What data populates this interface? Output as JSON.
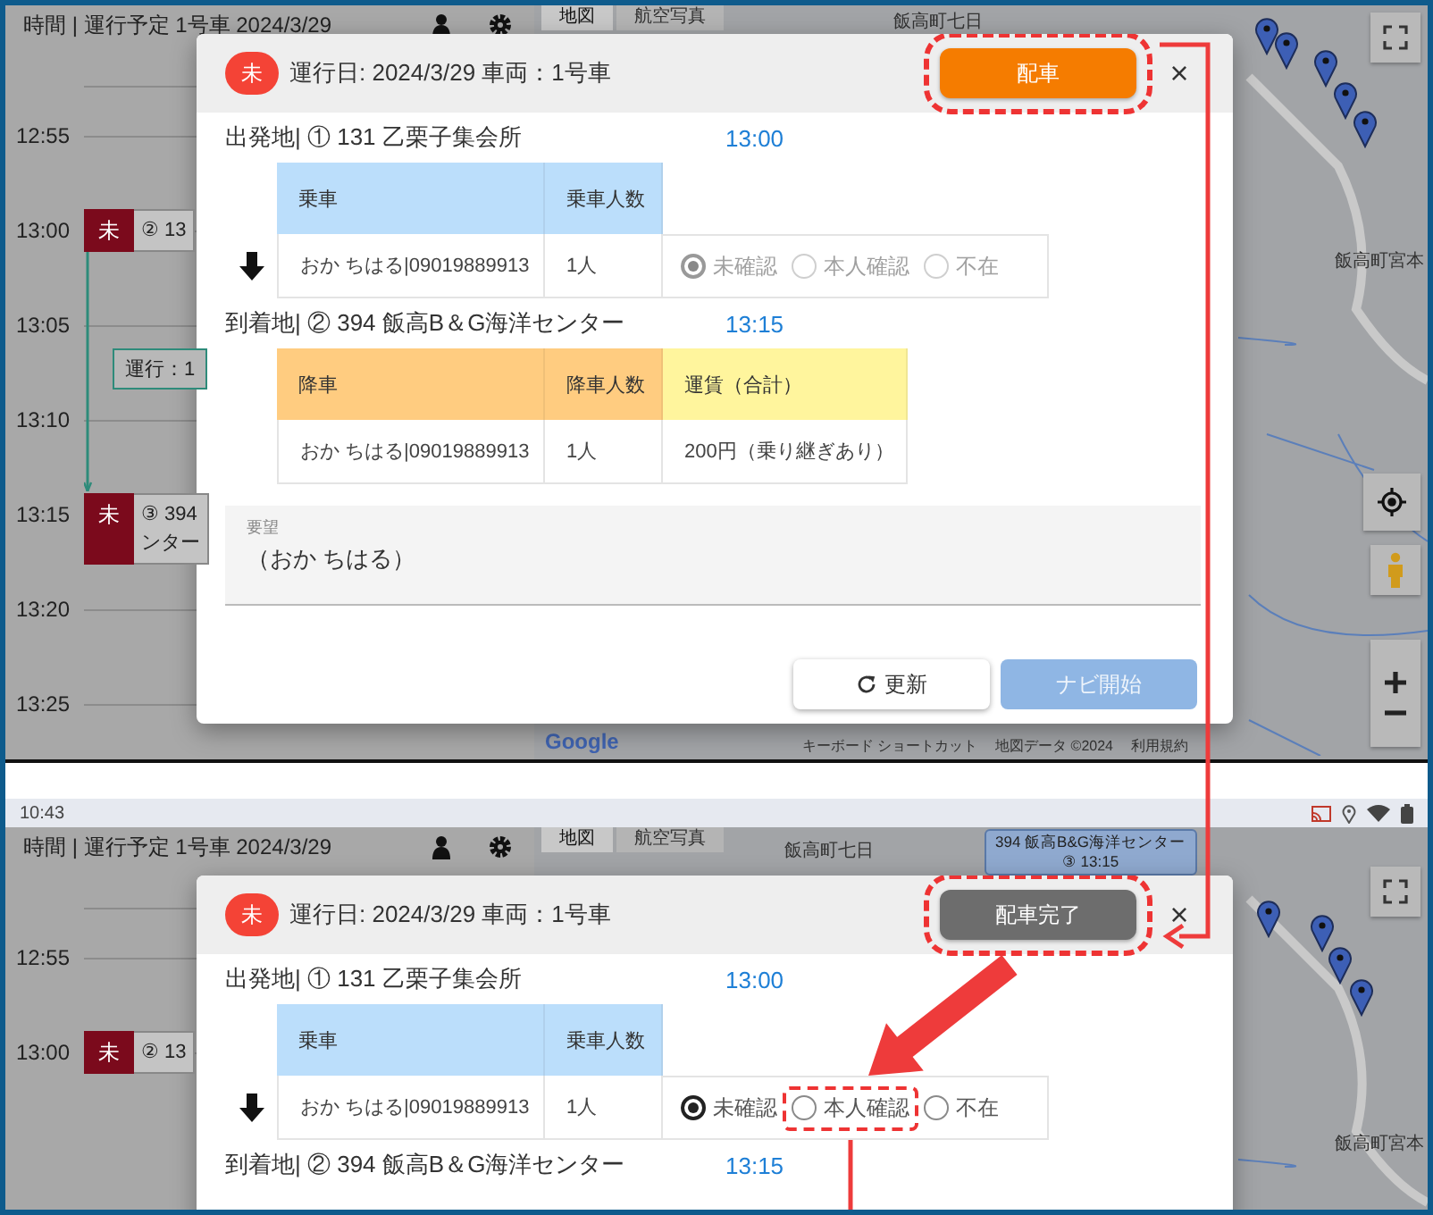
{
  "screens": [
    {
      "timeline": {
        "title": "時間 | 運行予定 1号車 2024/3/29",
        "slots": [
          {
            "time": "12:55"
          },
          {
            "time": "13:00",
            "event": {
              "badge": "未",
              "lines": [
                "② 13"
              ]
            }
          },
          {
            "time": "13:05",
            "note": "運行：1"
          },
          {
            "time": "13:10"
          },
          {
            "time": "13:15",
            "event": {
              "badge": "未",
              "lines": [
                "③ 394",
                "ンター"
              ]
            }
          },
          {
            "time": "13:20"
          },
          {
            "time": "13:25"
          }
        ]
      },
      "map": {
        "tabs": [
          {
            "label": "地図",
            "selected": true
          },
          {
            "label": "航空写真",
            "selected": false
          }
        ],
        "places": [
          "飯高町七日",
          "飯高町宮本"
        ],
        "logo": "Google",
        "attribution": [
          "キーボード ショートカット",
          "地図データ ©2024",
          "利用規約"
        ]
      },
      "dialog": {
        "badge": "未",
        "title": "運行日: 2024/3/29 車両：1号車",
        "dispatch_button": {
          "label": "配車",
          "kind": "pending",
          "highlighted": true
        },
        "close": "×",
        "stops": [
          {
            "kind": "pickup",
            "label": "出発地| ① 131 乙栗子集会所",
            "time": "13:00",
            "columns": [
              {
                "label": "乗車",
                "color": "#bbdefb"
              },
              {
                "label": "乗車人数",
                "color": "#bbdefb"
              }
            ],
            "rows": [
              {
                "cells": [
                  "おか ちはる|09019889913",
                  "1人"
                ],
                "presence": {
                  "disabled": true,
                  "options": [
                    {
                      "label": "未確認",
                      "selected": true,
                      "highlighted": false
                    },
                    {
                      "label": "本人確認",
                      "selected": false,
                      "highlighted": false
                    },
                    {
                      "label": "不在",
                      "selected": false,
                      "highlighted": false
                    }
                  ]
                }
              }
            ]
          },
          {
            "kind": "dropoff",
            "label": "到着地| ② 394 飯高B＆G海洋センター",
            "time": "13:15",
            "columns": [
              {
                "label": "降車",
                "color": "#ffcc80"
              },
              {
                "label": "降車人数",
                "color": "#ffcc80"
              },
              {
                "label": "運賃（合計）",
                "color": "#fff59d"
              }
            ],
            "rows": [
              {
                "cells": [
                  "おか ちはる|09019889913",
                  "1人",
                  "200円（乗り継ぎあり）"
                ]
              }
            ]
          }
        ],
        "request": {
          "label": "要望",
          "value": "（おか ちはる）"
        },
        "footer_buttons": [
          {
            "label": "更新",
            "kind": "refresh"
          },
          {
            "label": "ナビ開始",
            "kind": "primary",
            "disabled": true
          }
        ]
      }
    },
    {
      "status_bar": {
        "time": "10:43"
      },
      "timeline": {
        "title": "時間 | 運行予定 1号車 2024/3/29",
        "slots": [
          {
            "time": "12:55"
          },
          {
            "time": "13:00",
            "event": {
              "badge": "未",
              "lines": [
                "② 13"
              ]
            }
          }
        ]
      },
      "map": {
        "tabs": [
          {
            "label": "地図",
            "selected": true
          },
          {
            "label": "航空写真",
            "selected": false
          }
        ],
        "places": [
          "飯高町七日",
          "飯高町宮本"
        ],
        "popup": {
          "title": "394 飯高B&G海洋センター",
          "subtitle": "③ 13:15"
        }
      },
      "dialog": {
        "badge": "未",
        "title": "運行日: 2024/3/29 車両：1号車",
        "dispatch_button": {
          "label": "配車完了",
          "kind": "done",
          "highlighted": true
        },
        "close": "×",
        "stops": [
          {
            "kind": "pickup",
            "label": "出発地| ① 131 乙栗子集会所",
            "time": "13:00",
            "columns": [
              {
                "label": "乗車",
                "color": "#bbdefb"
              },
              {
                "label": "乗車人数",
                "color": "#bbdefb"
              }
            ],
            "rows": [
              {
                "cells": [
                  "おか ちはる|09019889913",
                  "1人"
                ],
                "presence": {
                  "disabled": false,
                  "options": [
                    {
                      "label": "未確認",
                      "selected": true,
                      "highlighted": false
                    },
                    {
                      "label": "本人確認",
                      "selected": false,
                      "highlighted": true
                    },
                    {
                      "label": "不在",
                      "selected": false,
                      "highlighted": false
                    }
                  ]
                }
              }
            ]
          },
          {
            "label": "到着地| ② 394 飯高B＆G海洋センター",
            "time": "13:15"
          }
        ]
      }
    }
  ]
}
